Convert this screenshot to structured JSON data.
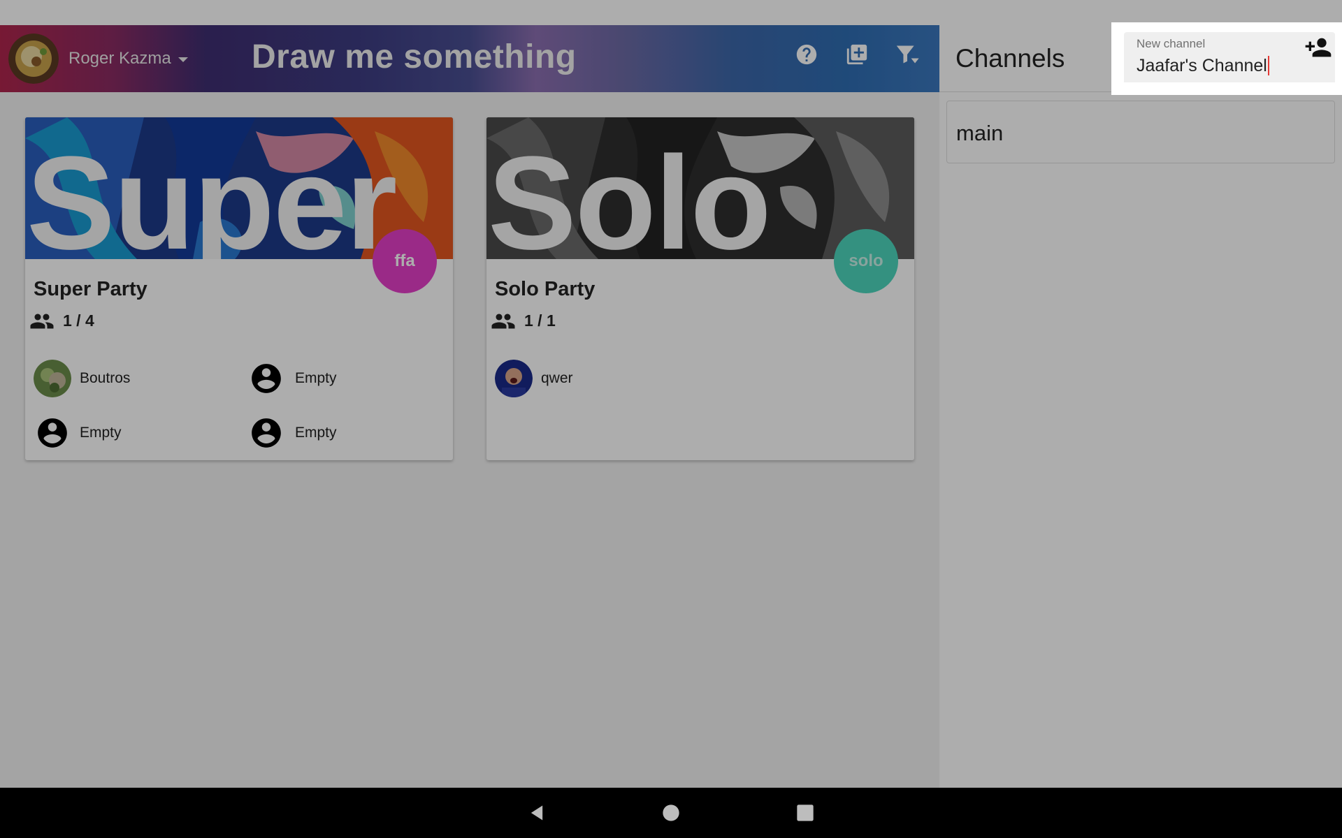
{
  "header": {
    "user_name": "Roger Kazma",
    "app_title": "Draw me something",
    "icons": [
      "help-icon",
      "add-box-icon",
      "filter-icon"
    ],
    "gradient_colors": [
      "#b0264d",
      "#3e2e72",
      "#8c6fb1",
      "#3b78be"
    ]
  },
  "parties": [
    {
      "banner_text": "Super",
      "title": "Super Party",
      "count": "1 / 4",
      "mode": "ffa",
      "mode_color": "#e43fc7",
      "players": [
        {
          "name": "Boutros",
          "avatar": "photo"
        },
        {
          "name": "Empty",
          "avatar": "account-circle-icon"
        },
        {
          "name": "Empty",
          "avatar": "account-circle-icon"
        },
        {
          "name": "Empty",
          "avatar": "account-circle-icon"
        }
      ]
    },
    {
      "banner_text": "Solo",
      "title": "Solo Party",
      "count": "1 / 1",
      "mode": "solo",
      "mode_color": "#4dd6bd",
      "players": [
        {
          "name": "qwer",
          "avatar": "photo"
        }
      ]
    }
  ],
  "channels": {
    "title": "Channels",
    "items": [
      {
        "name": "main"
      }
    ]
  },
  "new_channel": {
    "label": "New channel",
    "value": "Jaafar's Channel"
  },
  "nav": {
    "buttons": [
      "back-icon",
      "home-icon",
      "recents-icon"
    ]
  }
}
